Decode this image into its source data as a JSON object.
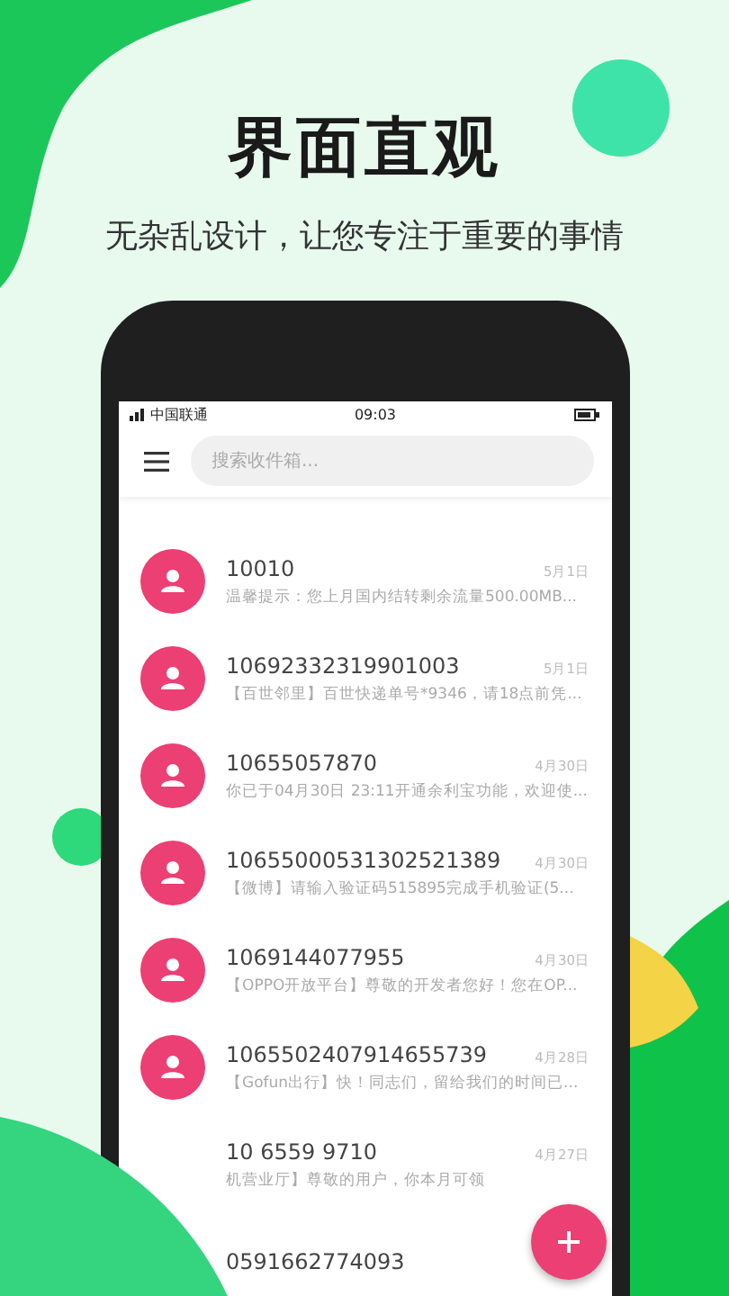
{
  "headline": "界面直观",
  "tagline": "无杂乱设计，让您专注于重要的事情",
  "status_bar": {
    "carrier": "中国联通",
    "time": "09:03"
  },
  "search": {
    "placeholder": "搜索收件箱..."
  },
  "messages": [
    {
      "sender": "10010",
      "date": "5月1日",
      "preview": "温馨提示：您上月国内结转剩余流量500.00MB..."
    },
    {
      "sender": "10692332319901003",
      "date": "5月1日",
      "preview": "【百世邻里】百世快递单号*9346，请18点前凭..."
    },
    {
      "sender": "10655057870",
      "date": "4月30日",
      "preview": "你已于04月30日 23:11开通余利宝功能，欢迎使..."
    },
    {
      "sender": "10655000531302521389",
      "date": "4月30日",
      "preview": "【微博】请输入验证码515895完成手机验证(5..."
    },
    {
      "sender": "1069144077955",
      "date": "4月30日",
      "preview": "【OPPO开放平台】尊敬的开发者您好！您在OP..."
    },
    {
      "sender": "1065502407914655739",
      "date": "4月28日",
      "preview": "【Gofun出行】快！同志们，留给我们的时间已..."
    },
    {
      "kind": "covered",
      "sender": "10 6559 9710",
      "date": "4月27日",
      "preview": "机营业厅】尊敬的用户，你本月可领"
    },
    {
      "kind": "covered",
      "sender": "0591662774093"
    }
  ]
}
